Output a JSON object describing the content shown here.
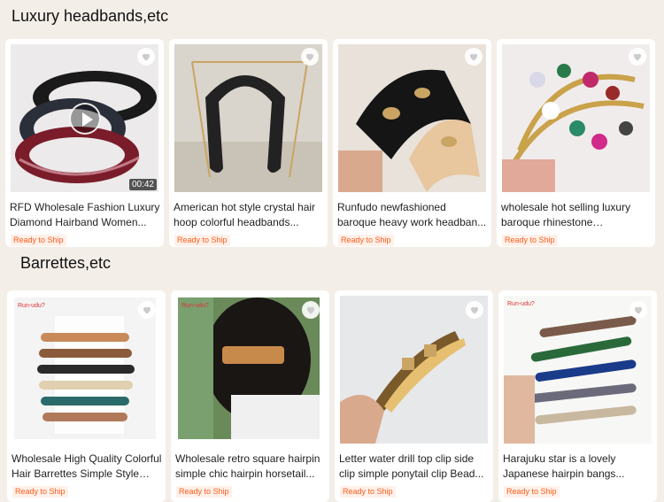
{
  "sections": [
    {
      "title": "Luxury headbands,etc",
      "products": [
        {
          "title": "RFD Wholesale Fashion Luxury Diamond Hairband Women...",
          "badge": "Ready to Ship",
          "duration": "00:42"
        },
        {
          "title": "American hot style crystal hair hoop colorful headbands...",
          "badge": "Ready to Ship"
        },
        {
          "title": "Runfudo newfashioned baroque heavy work headban...",
          "badge": "Ready to Ship"
        },
        {
          "title": "wholesale hot selling luxury baroque rhinestone headband...",
          "badge": "Ready to Ship"
        }
      ]
    },
    {
      "title": "Barrettes,etc",
      "products": [
        {
          "title": "Wholesale High Quality Colorful Hair Barrettes Simple Style Ha...",
          "badge": "Ready to Ship",
          "brand": "Run-udu?"
        },
        {
          "title": "Wholesale retro square hairpin simple chic hairpin horsetail...",
          "badge": "Ready to Ship",
          "brand": "Run-udu?"
        },
        {
          "title": "Letter water drill top clip side clip simple ponytail clip Bead...",
          "badge": "Ready to Ship"
        },
        {
          "title": "Harajuku star is a lovely Japanese hairpin bangs...",
          "badge": "Ready to Ship",
          "brand": "Run-udu?"
        }
      ]
    }
  ],
  "icons": {
    "favorite": "heart-icon",
    "play": "play-icon"
  },
  "colors": {
    "page_bg": "#f3eee7",
    "badge_text": "#ff5b1a",
    "badge_bg": "#fff1ea"
  }
}
